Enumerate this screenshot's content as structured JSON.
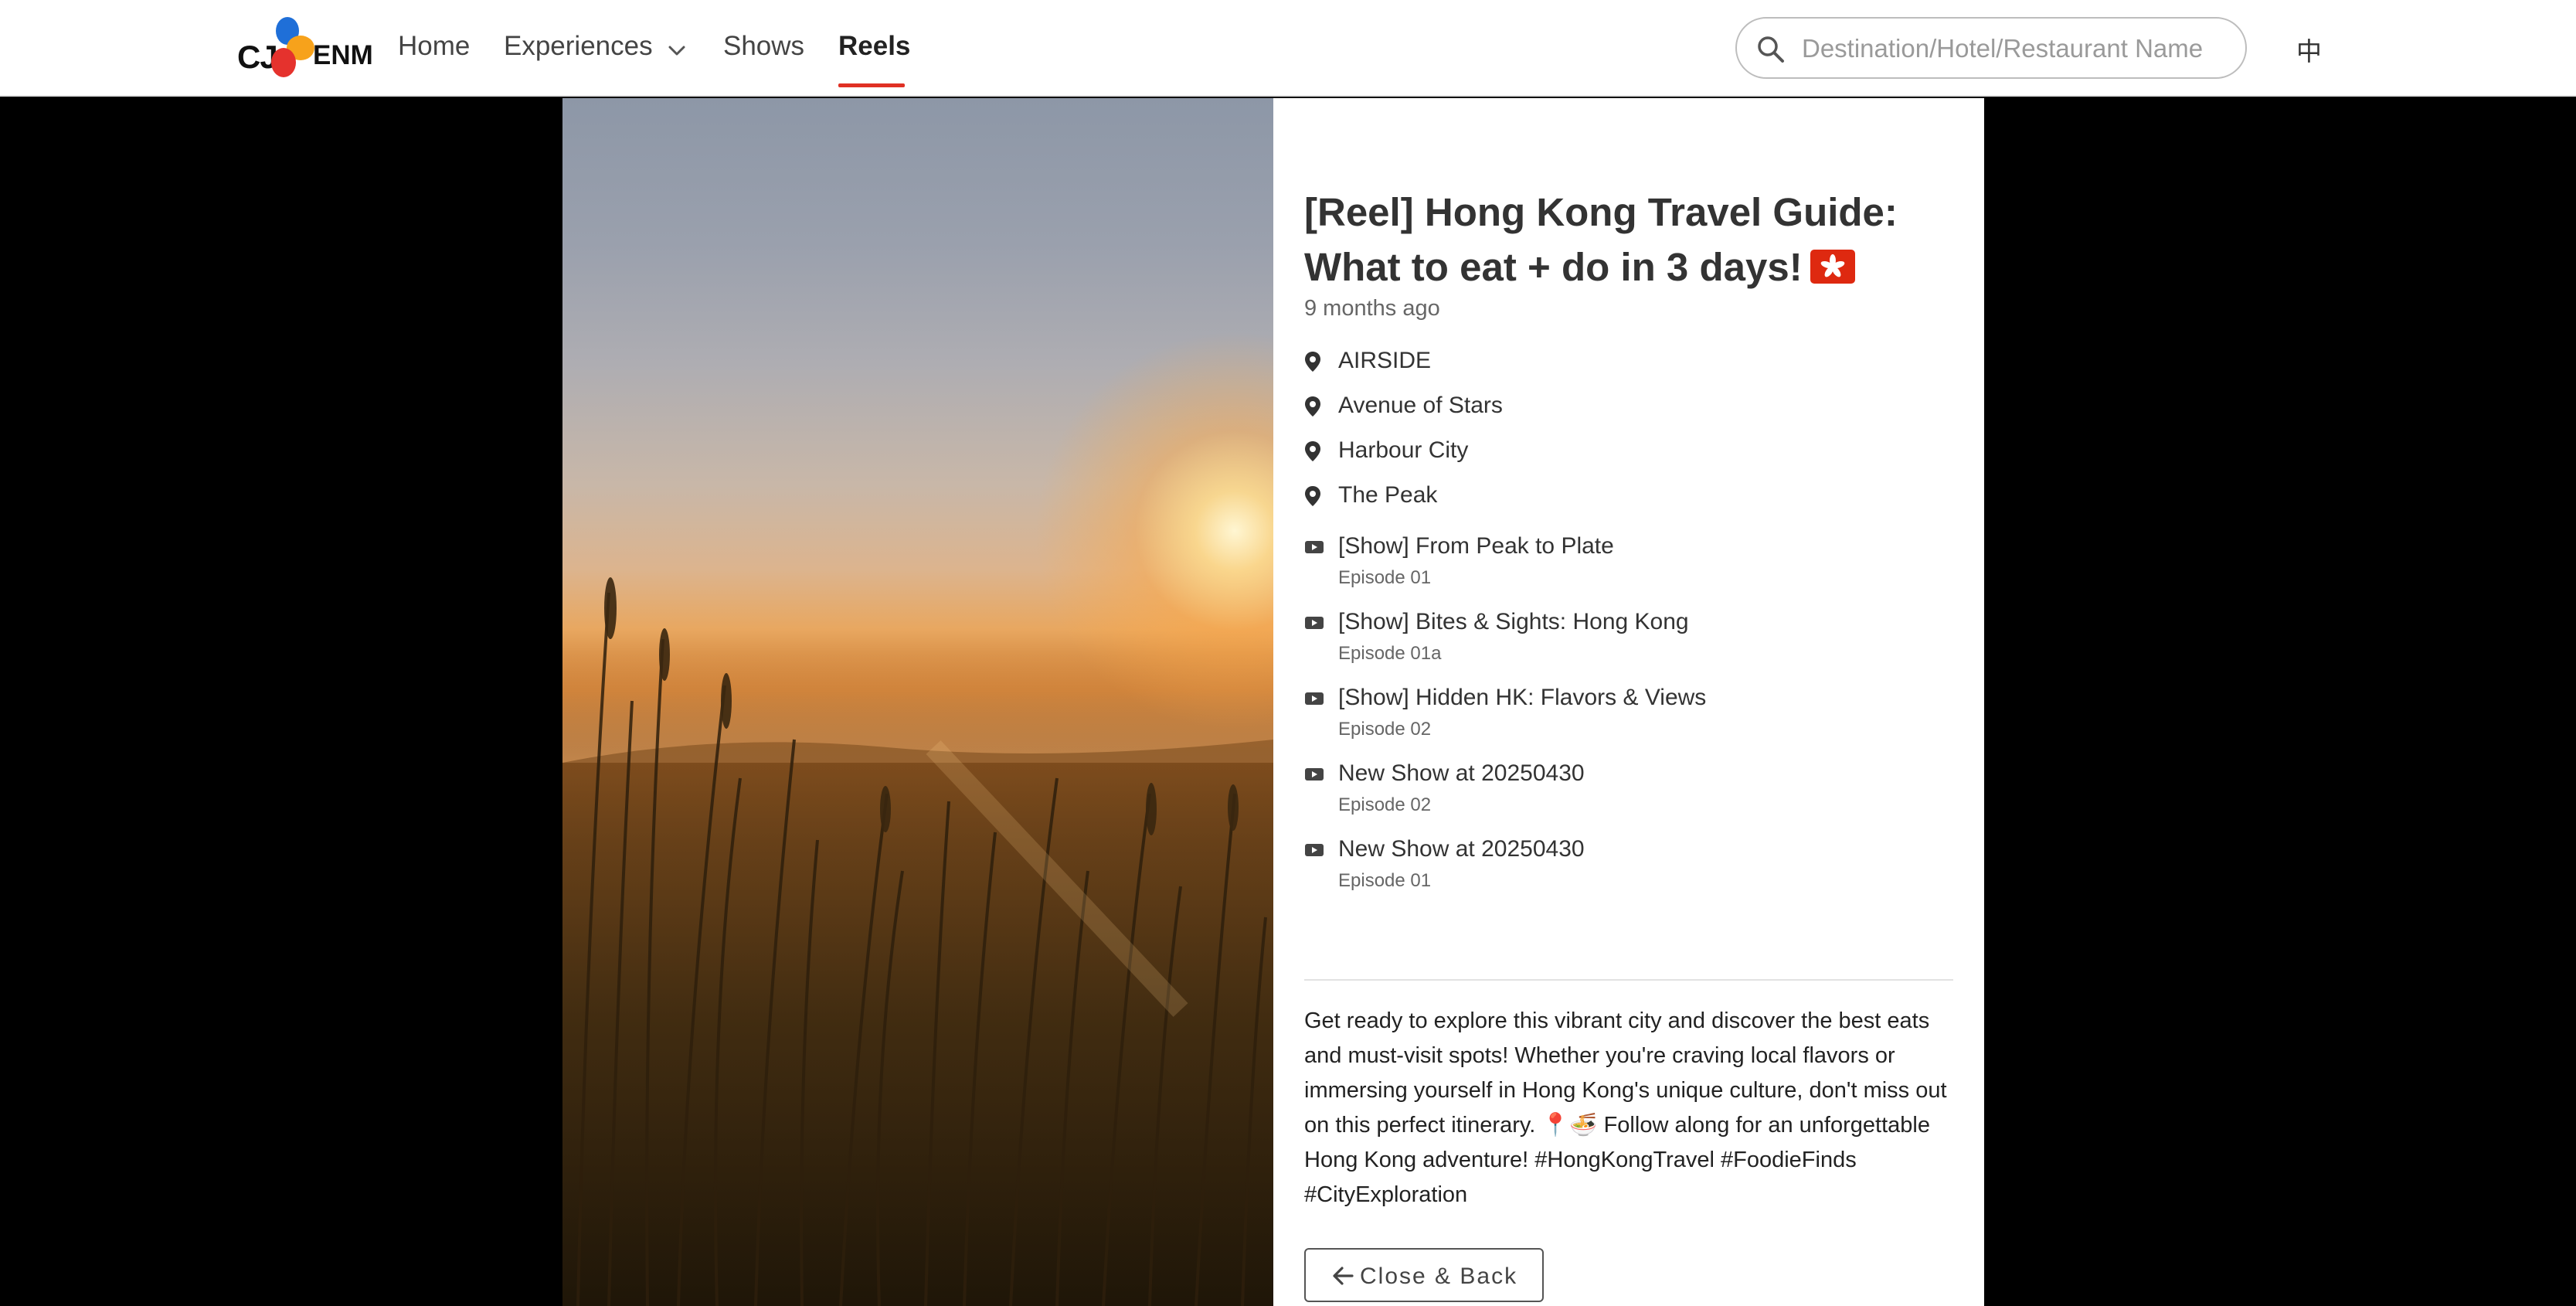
{
  "brand": {
    "logo_text_left": "CJ",
    "logo_text_right": "ENM"
  },
  "nav": {
    "items": [
      {
        "label": "Home"
      },
      {
        "label": "Experiences"
      },
      {
        "label": "Shows"
      },
      {
        "label": "Reels"
      }
    ],
    "active": "Reels",
    "accent_color": "#e03024"
  },
  "search": {
    "placeholder": "Destination/Hotel/Restaurant Name",
    "value": ""
  },
  "language_toggle": "中",
  "reel": {
    "title": "[Reel] Hong Kong Travel Guide: What to eat + do in 3 days!",
    "title_flag_icon": "hong-kong-flag-icon",
    "posted": "9 months ago",
    "locations": [
      {
        "name": "AIRSIDE"
      },
      {
        "name": "Avenue of Stars"
      },
      {
        "name": "Harbour City"
      },
      {
        "name": "The Peak"
      }
    ],
    "shows": [
      {
        "title": "[Show] From Peak to Plate",
        "episode": "Episode 01"
      },
      {
        "title": "[Show] Bites & Sights: Hong Kong",
        "episode": "Episode 01a"
      },
      {
        "title": "[Show] Hidden HK: Flavors & Views",
        "episode": "Episode 02"
      },
      {
        "title": "New Show at 20250430",
        "episode": "Episode 02"
      },
      {
        "title": "New Show at 20250430",
        "episode": "Episode 01"
      }
    ],
    "description": "Get ready to explore this vibrant city and discover the best eats and must-visit spots! Whether you're craving local flavors or immersing yourself in Hong Kong's unique culture, don't miss out on this perfect itinerary. 📍🍜 Follow along for an unforgettable Hong Kong adventure! #HongKongTravel #FoodieFinds #CityExploration",
    "close_label": "Close & Back"
  }
}
